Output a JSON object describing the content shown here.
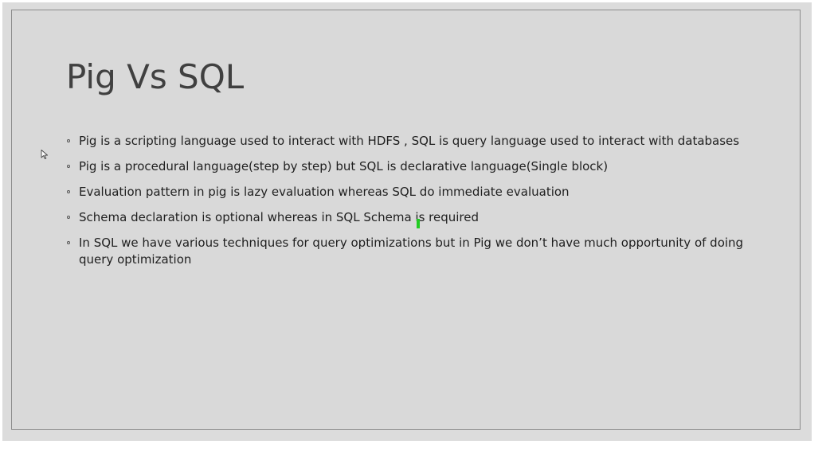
{
  "slide": {
    "title": "Pig Vs SQL",
    "bullets": [
      "Pig is a scripting language used to interact with HDFS , SQL is query language used to interact with databases",
      "Pig is a procedural language(step by step) but SQL is declarative language(Single block)",
      "Evaluation pattern in pig is lazy evaluation whereas SQL do immediate evaluation",
      "Schema declaration is optional whereas in SQL Schema is required",
      "In SQL we have various techniques for query optimizations but in Pig we don’t have much opportunity of doing query optimization"
    ]
  },
  "overlays": {
    "cursor_icon": "mouse-pointer-icon",
    "marker_color": "#22cc22"
  }
}
